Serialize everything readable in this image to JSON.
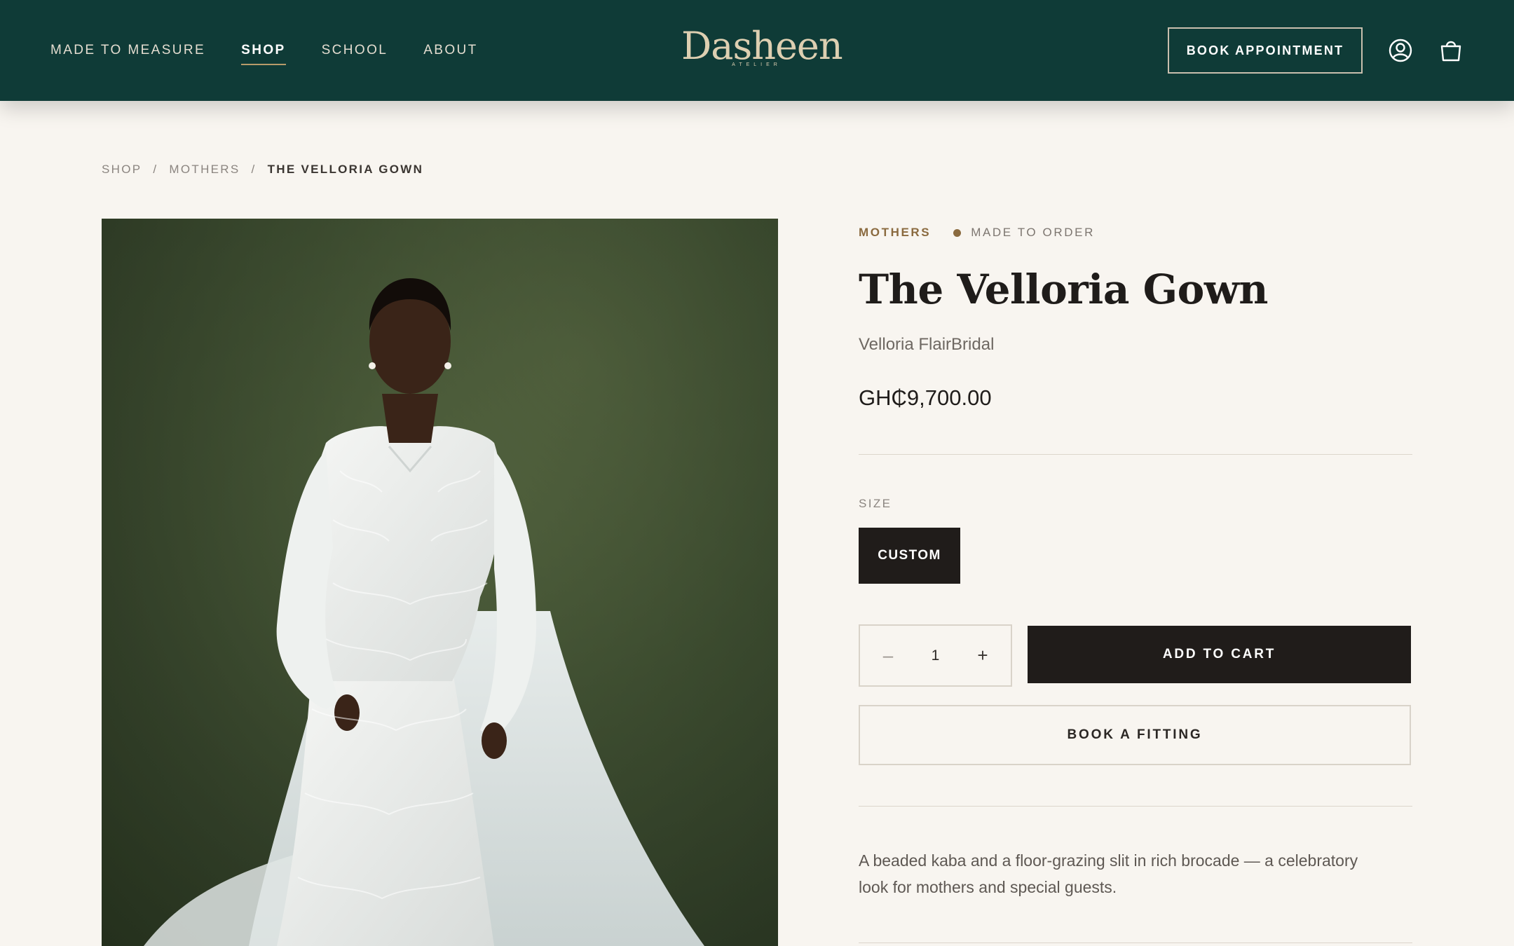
{
  "colors": {
    "header_bg": "#0f3b37",
    "page_bg": "#f8f5f0",
    "accent": "#8a6a3f",
    "dark_button": "#201c1a"
  },
  "header": {
    "nav": [
      {
        "label": "MADE TO MEASURE"
      },
      {
        "label": "SHOP",
        "active": true
      },
      {
        "label": "SCHOOL"
      },
      {
        "label": "ABOUT"
      }
    ],
    "logo": {
      "main": "Dasheen",
      "sub": "ATELIER"
    },
    "book_appointment_label": "BOOK APPOINTMENT",
    "icons": [
      "user-icon",
      "shopping-bag-icon"
    ]
  },
  "breadcrumb": {
    "items": [
      "SHOP",
      "MOTHERS",
      "THE VELLORIA GOWN"
    ],
    "separator": "/"
  },
  "product": {
    "category": "MOTHERS",
    "availability": "MADE TO ORDER",
    "title": "The Velloria Gown",
    "brand": "Velloria FlairBridal",
    "price": "GH₵9,700.00",
    "size_label": "SIZE",
    "size_option": "CUSTOM",
    "quantity": "1",
    "quantity_minus": "–",
    "quantity_plus": "+",
    "add_to_cart_label": "ADD TO CART",
    "book_fitting_label": "BOOK A FITTING",
    "description": "A beaded kaba and a floor-grazing slit in rich brocade — a celebratory look for mothers and special guests."
  }
}
